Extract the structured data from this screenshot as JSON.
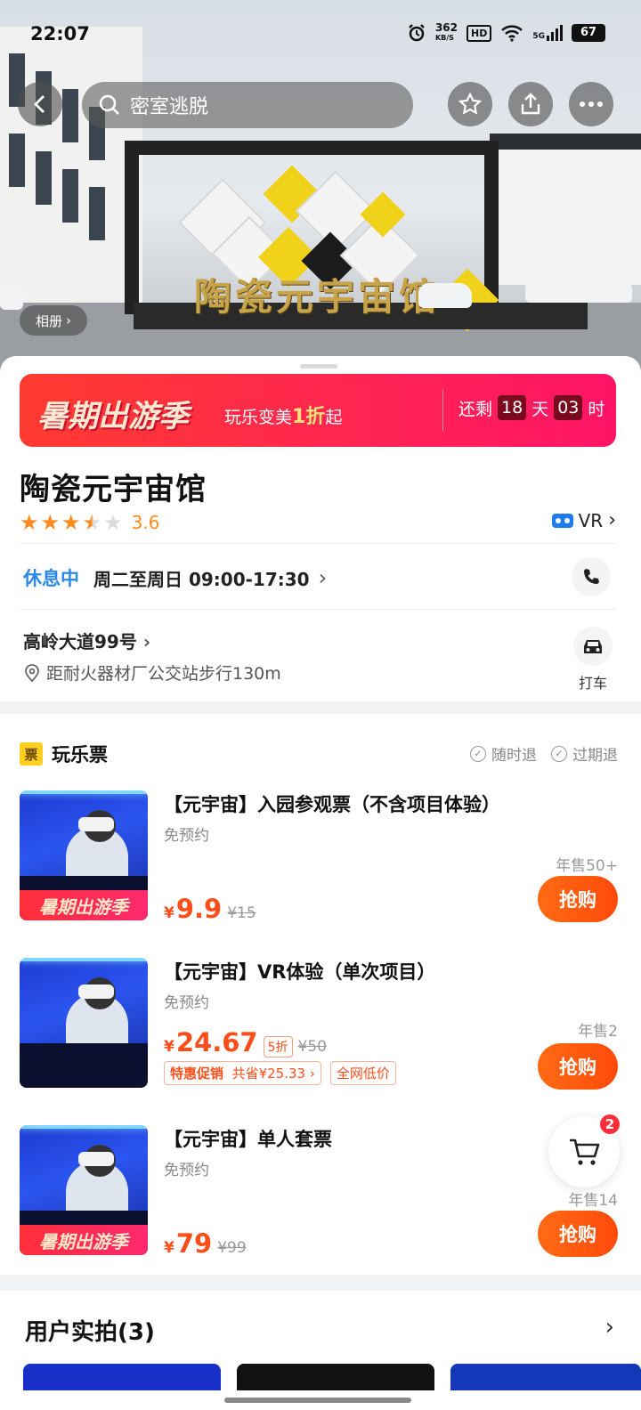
{
  "status_bar": {
    "time": "22:07",
    "net_speed_top": "362",
    "net_speed_bottom": "KB/S",
    "hd": "HD",
    "signal": "5G",
    "battery": "67"
  },
  "nav": {
    "search_placeholder": "密室逃脱"
  },
  "hero": {
    "sign_text": "陶瓷元宇宙馆",
    "album_label": "相册"
  },
  "promo": {
    "title": "暑期出游季",
    "sub_prefix": "玩乐变美",
    "sub_highlight": "1折",
    "sub_suffix": "起",
    "remaining_label": "还剩",
    "days": "18",
    "days_unit": "天",
    "hours": "03",
    "hours_unit": "时"
  },
  "place": {
    "name": "陶瓷元宇宙馆",
    "rating": "3.6",
    "rating_stars": 3.6,
    "vr_label": "VR",
    "status": "休息中",
    "hours": "周二至周日 09:00-17:30",
    "address": "高岭大道99号",
    "distance": "距耐火器材厂公交站步行130m",
    "taxi_label": "打车"
  },
  "tickets": {
    "section_icon": "票",
    "section_title": "玩乐票",
    "tag_refund_anytime": "随时退",
    "tag_refund_expired": "过期退",
    "items": [
      {
        "name": "【元宇宙】入园参观票（不含项目体验）",
        "sub": "免预约",
        "yen": "¥",
        "price": "9.9",
        "original": "¥15",
        "sold": "年售50+",
        "buy": "抢购",
        "badge": "暑期出游季"
      },
      {
        "name": "【元宇宙】VR体验（单次项目）",
        "sub": "免预约",
        "yen": "¥",
        "price": "24.67",
        "discount": "5折",
        "original": "¥50",
        "tag_promo": "特惠促销",
        "tag_save": "共省¥25.33",
        "tag_lowest": "全网低价",
        "sold": "年售2",
        "buy": "抢购"
      },
      {
        "name": "【元宇宙】单人套票",
        "sub": "免预约",
        "yen": "¥",
        "price": "79",
        "original": "¥99",
        "sold": "年售14",
        "buy": "抢购",
        "badge": "暑期出游季"
      }
    ]
  },
  "cart": {
    "count": "2"
  },
  "photos": {
    "title": "用户实拍(3)"
  },
  "colors": {
    "accent": "#ff4d1a",
    "promo": "#ff2354",
    "status_blue": "#2a88e6",
    "star": "#ff8a1f"
  }
}
